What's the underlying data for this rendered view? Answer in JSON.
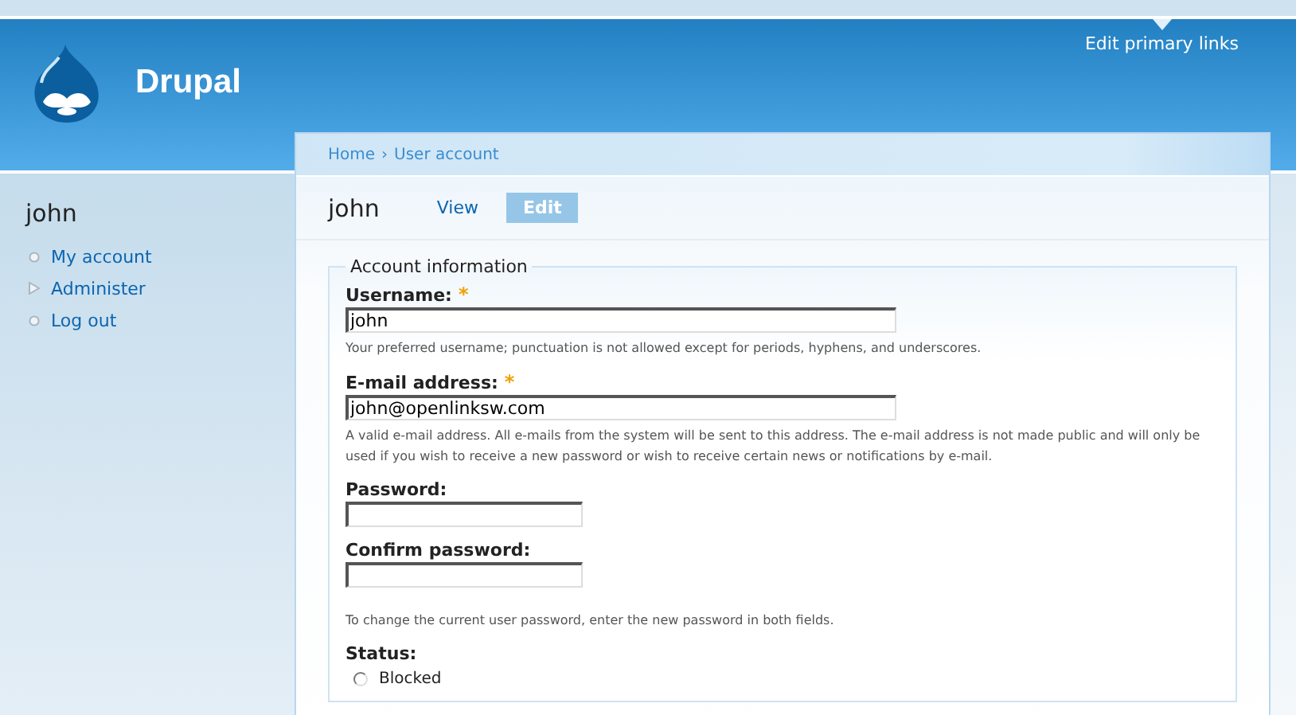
{
  "header": {
    "site_name": "Drupal",
    "primary_links_link": "Edit primary links"
  },
  "sidebar": {
    "title": "john",
    "items": [
      {
        "label": "My account",
        "kind": "leaf"
      },
      {
        "label": "Administer",
        "kind": "collapsed"
      },
      {
        "label": "Log out",
        "kind": "leaf"
      }
    ]
  },
  "breadcrumb": [
    "Home",
    "User account"
  ],
  "breadcrumb_separator": "›",
  "page_title": "john",
  "tabs": [
    {
      "label": "View",
      "selected": false
    },
    {
      "label": "Edit",
      "selected": true
    }
  ],
  "fieldset": {
    "legend": "Account information",
    "fields": [
      {
        "kind": "text",
        "label": "Username:",
        "required": true,
        "value": "john",
        "description": "Your preferred username; punctuation is not allowed except for periods, hyphens, and underscores."
      },
      {
        "kind": "text",
        "label": "E-mail address:",
        "required": true,
        "value": "john@openlinksw.com",
        "description": "A valid e-mail address. All e-mails from the system will be sent to this address. The e-mail address is not made public and will only be used if you wish to receive a new password or wish to receive certain news or notifications by e-mail."
      },
      {
        "kind": "password",
        "label": "Password:",
        "required": false
      },
      {
        "kind": "password",
        "label": "Confirm password:",
        "required": false,
        "description": "To change the current user password, enter the new password in both fields."
      },
      {
        "kind": "radios",
        "label": "Status:",
        "required": false,
        "options": [
          {
            "label": "Blocked",
            "selected": false
          }
        ]
      }
    ]
  },
  "required_mark": "*"
}
